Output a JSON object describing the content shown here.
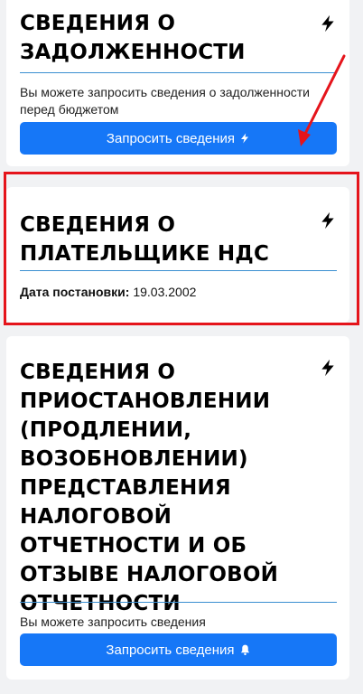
{
  "cards": [
    {
      "title": "СВЕДЕНИЯ О ЗАДОЛЖЕННОСТИ",
      "description": "Вы можете запросить сведения о задолженности перед бюджетом",
      "button_label": "Запросить сведения",
      "button_icon": "lightning-icon"
    },
    {
      "title": "СВЕДЕНИЯ О ПЛАТЕЛЬЩИКЕ НДС",
      "registration_label": "Дата постановки:",
      "registration_date": "19.03.2002"
    },
    {
      "title": "СВЕДЕНИЯ О ПРИОСТАНОВЛЕНИИ (ПРОДЛЕНИИ, ВОЗОБНОВЛЕНИИ) ПРЕДСТАВЛЕНИЯ НАЛОГОВОЙ ОТЧЕТНОСТИ И ОБ ОТЗЫВЕ НАЛОГОВОЙ ОТЧЕТНОСТИ",
      "description": "Вы можете запросить сведения",
      "button_label": "Запросить сведения",
      "button_icon": "bell-icon"
    }
  ],
  "colors": {
    "accent": "#1677f7",
    "divider": "#3a8fd1",
    "annotation": "#e5141b",
    "background": "#f1f2f4"
  }
}
